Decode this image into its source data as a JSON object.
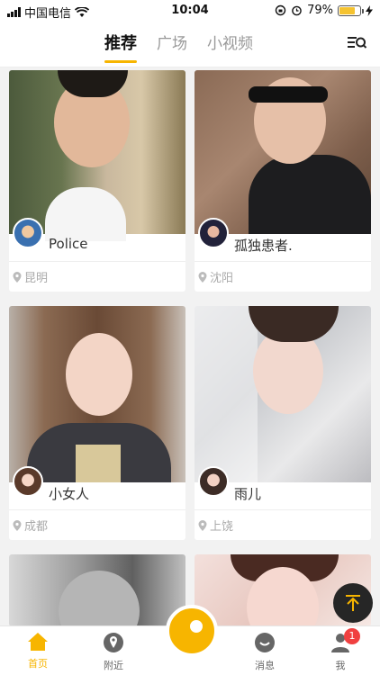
{
  "status_bar": {
    "carrier": "中国电信",
    "time": "10:04",
    "battery_percent": "79%",
    "battery_level": 0.79
  },
  "tabs": [
    {
      "label": "推荐",
      "active": true
    },
    {
      "label": "广场",
      "active": false
    },
    {
      "label": "小视频",
      "active": false
    }
  ],
  "cards": [
    {
      "name": "Police",
      "location": "昆明"
    },
    {
      "name": "孤独患者.",
      "location": "沈阳"
    },
    {
      "name": "小女人",
      "location": "成都"
    },
    {
      "name": "雨儿",
      "location": "上饶"
    }
  ],
  "bottom_nav": {
    "home": "首页",
    "nearby": "附近",
    "messages": "消息",
    "me": "我",
    "me_badge": "1"
  },
  "colors": {
    "accent": "#f7b500",
    "badge": "#f04040"
  }
}
